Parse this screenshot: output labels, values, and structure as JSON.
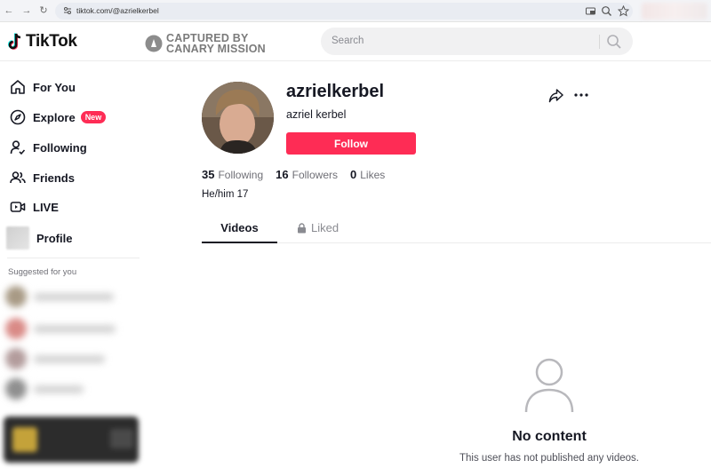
{
  "browser": {
    "url": "tiktok.com/@azrielkerbel",
    "back_icon": "arrow-left-icon",
    "forward_icon": "arrow-right-icon",
    "reload_icon": "reload-icon"
  },
  "header": {
    "brand": "TikTok",
    "watermark_line1": "CAPTURED BY",
    "watermark_line2": "CANARY MISSION",
    "search_placeholder": "Search"
  },
  "sidebar": {
    "items": [
      {
        "label": "For You",
        "icon": "home-icon"
      },
      {
        "label": "Explore",
        "icon": "compass-icon",
        "badge": "New"
      },
      {
        "label": "Following",
        "icon": "user-follow-icon"
      },
      {
        "label": "Friends",
        "icon": "friends-icon"
      },
      {
        "label": "LIVE",
        "icon": "live-icon"
      },
      {
        "label": "Profile",
        "icon": "avatar"
      }
    ],
    "suggested_title": "Suggested for you"
  },
  "profile": {
    "username": "azrielkerbel",
    "nickname": "azriel kerbel",
    "follow_label": "Follow",
    "following_count": "35",
    "following_label": "Following",
    "followers_count": "16",
    "followers_label": "Followers",
    "likes_count": "0",
    "likes_label": "Likes",
    "bio": "He/him 17"
  },
  "tabs": {
    "videos": "Videos",
    "liked": "Liked"
  },
  "empty_state": {
    "title": "No content",
    "subtitle": "This user has not published any videos."
  },
  "colors": {
    "accent": "#fe2c55",
    "text": "#161823",
    "muted": "#8a8b91"
  }
}
